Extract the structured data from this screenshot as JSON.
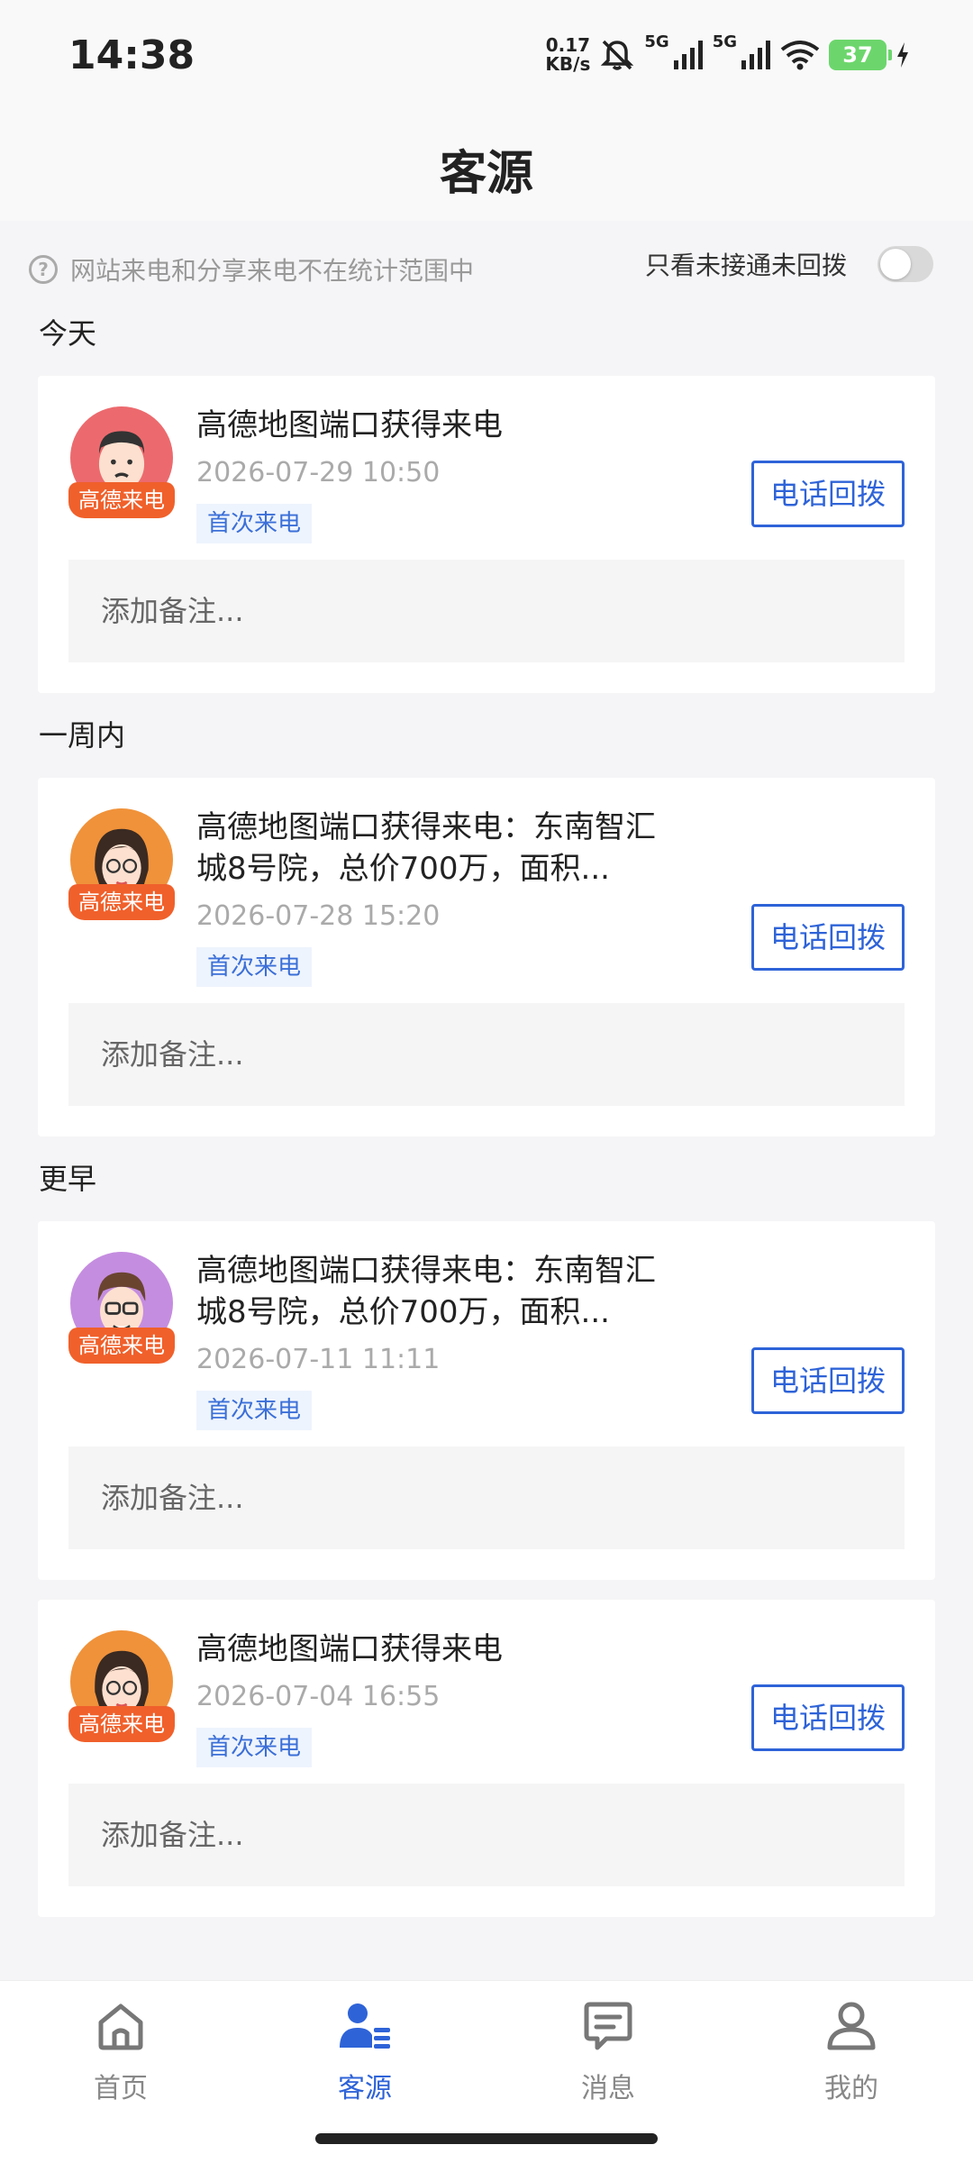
{
  "status_bar": {
    "time": "14:38",
    "net_speed_value": "0.17",
    "net_speed_unit": "KB/s",
    "signal1_label": "5G",
    "signal2_label": "5G",
    "battery": "37"
  },
  "header": {
    "title": "客源"
  },
  "notice": {
    "text": "网站来电和分享来电不在统计范围中",
    "filter_label": "只看未接通未回拨",
    "filter_on": false
  },
  "sections": {
    "today": "今天",
    "week": "一周内",
    "earlier": "更早"
  },
  "cards": [
    {
      "title": "高德地图端口获得来电",
      "time": "2026-07-29 10:50",
      "tag": "首次来电",
      "badge": "高德来电",
      "button": "电话回拨",
      "note_placeholder": "添加备注..."
    },
    {
      "title": "高德地图端口获得来电：东南智汇城8号院，总价700万，面积...",
      "time": "2026-07-28 15:20",
      "tag": "首次来电",
      "badge": "高德来电",
      "button": "电话回拨",
      "note_placeholder": "添加备注..."
    },
    {
      "title": "高德地图端口获得来电：东南智汇城8号院，总价700万，面积...",
      "time": "2026-07-11 11:11",
      "tag": "首次来电",
      "badge": "高德来电",
      "button": "电话回拨",
      "note_placeholder": "添加备注..."
    },
    {
      "title": "高德地图端口获得来电",
      "time": "2026-07-04 16:55",
      "tag": "首次来电",
      "badge": "高德来电",
      "button": "电话回拨",
      "note_placeholder": "添加备注..."
    }
  ],
  "tabs": [
    {
      "label": "首页",
      "icon": "home-icon"
    },
    {
      "label": "客源",
      "icon": "customers-icon",
      "active": true
    },
    {
      "label": "消息",
      "icon": "message-icon"
    },
    {
      "label": "我的",
      "icon": "profile-icon"
    }
  ],
  "colors": {
    "accent": "#2e63d8",
    "badge": "#f0602b",
    "tag_bg": "#eef4fd"
  }
}
